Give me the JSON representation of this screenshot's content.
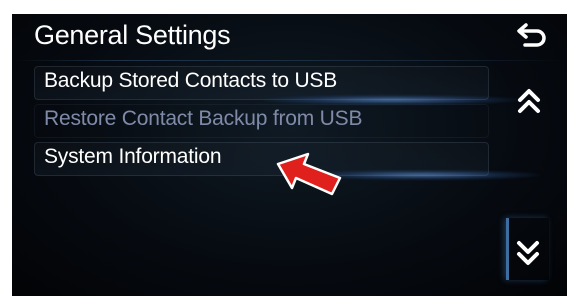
{
  "header": {
    "title": "General Settings",
    "back_icon": "back-return-icon"
  },
  "menu": {
    "items": [
      {
        "label": "Backup Stored Contacts to USB",
        "enabled": true
      },
      {
        "label": "Restore Contact Backup from USB",
        "enabled": false
      },
      {
        "label": "System Information",
        "enabled": true
      }
    ]
  },
  "scroll": {
    "up_icon": "double-chevron-up-icon",
    "down_icon": "double-chevron-down-icon"
  },
  "annotation": {
    "pointer_icon": "red-arrow-pointer-icon",
    "pointer_color": "#e0201c"
  },
  "colors": {
    "background": "#060a10",
    "text": "#ffffff",
    "disabled_text": "#7f8aa8",
    "accent": "#3c6fa0"
  }
}
